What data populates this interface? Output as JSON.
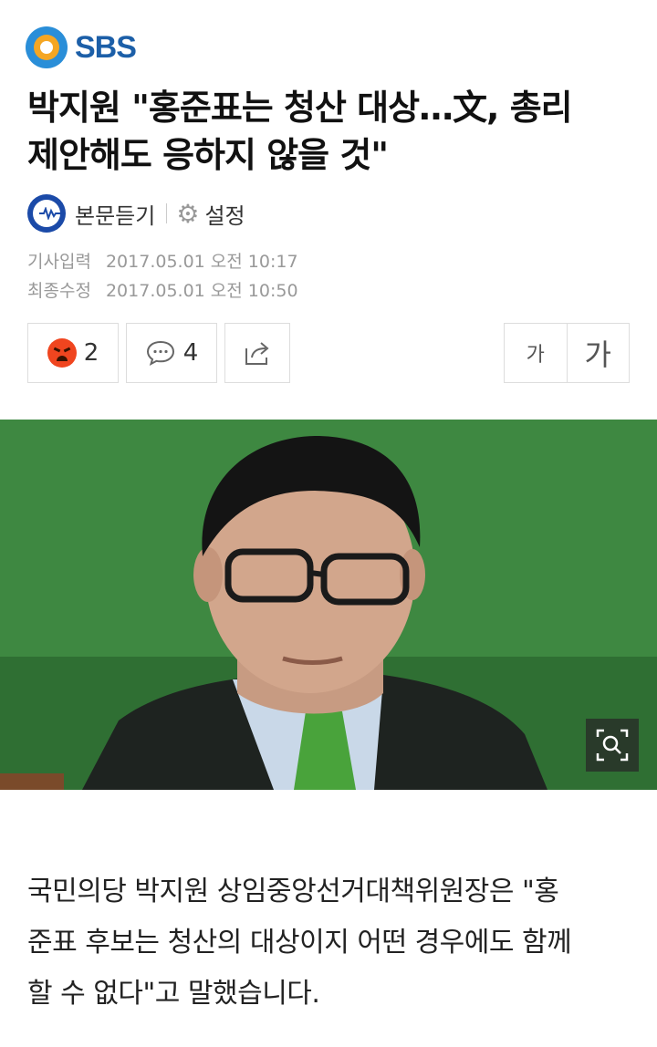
{
  "brand": {
    "name": "SBS"
  },
  "article": {
    "headline_line1": "박지원 \"홍준표는 청산 대상…文, 총리",
    "headline_line2": "제안해도 응하지 않을 것\"",
    "body_line1": "국민의당 박지원 상임중앙선거대책위원장은 \"홍",
    "body_line2": "준표 후보는 청산의 대상이지 어떤 경우에도 함께",
    "body_line3": "할 수 없다\"고 말했습니다."
  },
  "utilities": {
    "tts_label": "본문듣기",
    "settings_label": "설정"
  },
  "meta": {
    "published_label": "기사입력",
    "published_value": "2017.05.01 오전 10:17",
    "modified_label": "최종수정",
    "modified_value": "2017.05.01 오전 10:50"
  },
  "actions": {
    "reaction_count": "2",
    "comment_count": "4",
    "font_small_label": "가",
    "font_large_label": "가"
  },
  "icons": {
    "reaction": "angry-face-icon",
    "comment": "comment-bubble-icon",
    "share": "share-icon",
    "zoom": "zoom-icon",
    "tts": "tts-icon",
    "settings": "gear-icon"
  },
  "colors": {
    "brand_blue": "#1c5fa8",
    "brand_orange": "#f5a623",
    "angry_red": "#f0451f",
    "photo_green": "#3f8a42"
  }
}
